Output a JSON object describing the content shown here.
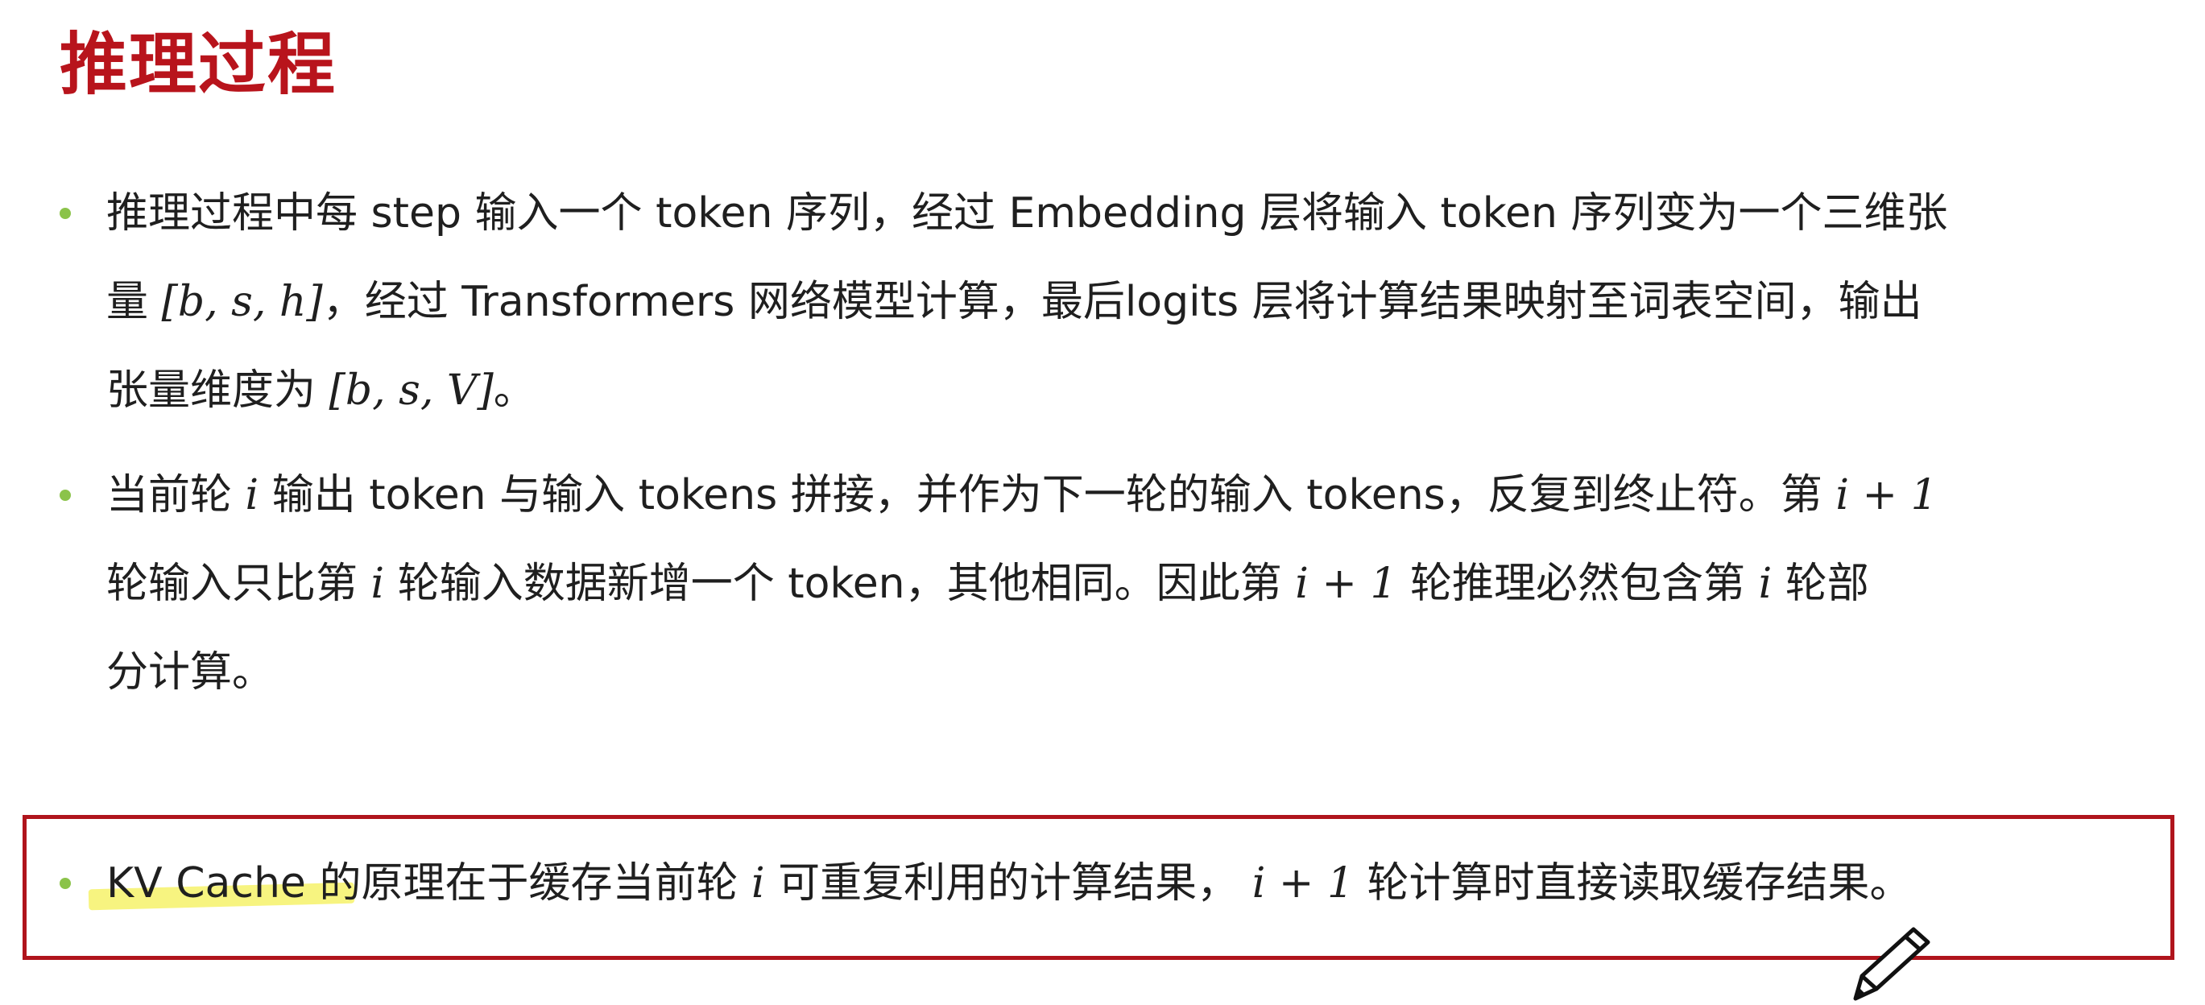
{
  "title": "推理过程",
  "bullets": [
    {
      "lines": [
        "推理过程中每 step 输入一个 token 序列，经过 Embedding 层将输入 token 序列变为一个三维张",
        {
          "pre": "量 ",
          "math": "[b, s, h]",
          "post": "，经过 Transformers 网络模型计算，最后logits 层将计算结果映射至词表空间，输出"
        },
        {
          "pre": "张量维度为 ",
          "math": "[b, s, V]",
          "post": "。"
        }
      ]
    },
    {
      "lines": [
        {
          "pre": "当前轮 ",
          "math": "i",
          "mid": " 输出 token 与输入 tokens 拼接，并作为下一轮的输入 tokens，反复到终止符。第 ",
          "math2": "i + 1"
        },
        {
          "pre": " 轮输入只比第 ",
          "math": "i",
          "mid": " 轮输入数据新增一个 token，其他相同。因此第 ",
          "math2": "i + 1",
          "mid2": " 轮推理必然包含第 ",
          "math3": "i",
          "post": " 轮部"
        },
        "分计算。"
      ]
    },
    {
      "lines": [
        {
          "pre": "KV Cache 的原理在于缓存当前轮 ",
          "math": "i",
          "mid": " 可重复利用的计算结果， ",
          "math2": "i + 1",
          "post": " 轮计算时直接读取缓存结果。"
        }
      ]
    }
  ],
  "colors": {
    "title": "#b8141c",
    "bullet": "#8bc34a",
    "box_border": "#b0141c",
    "marker": "#f6f26a"
  },
  "icons": {
    "pen": "pencil-icon"
  }
}
